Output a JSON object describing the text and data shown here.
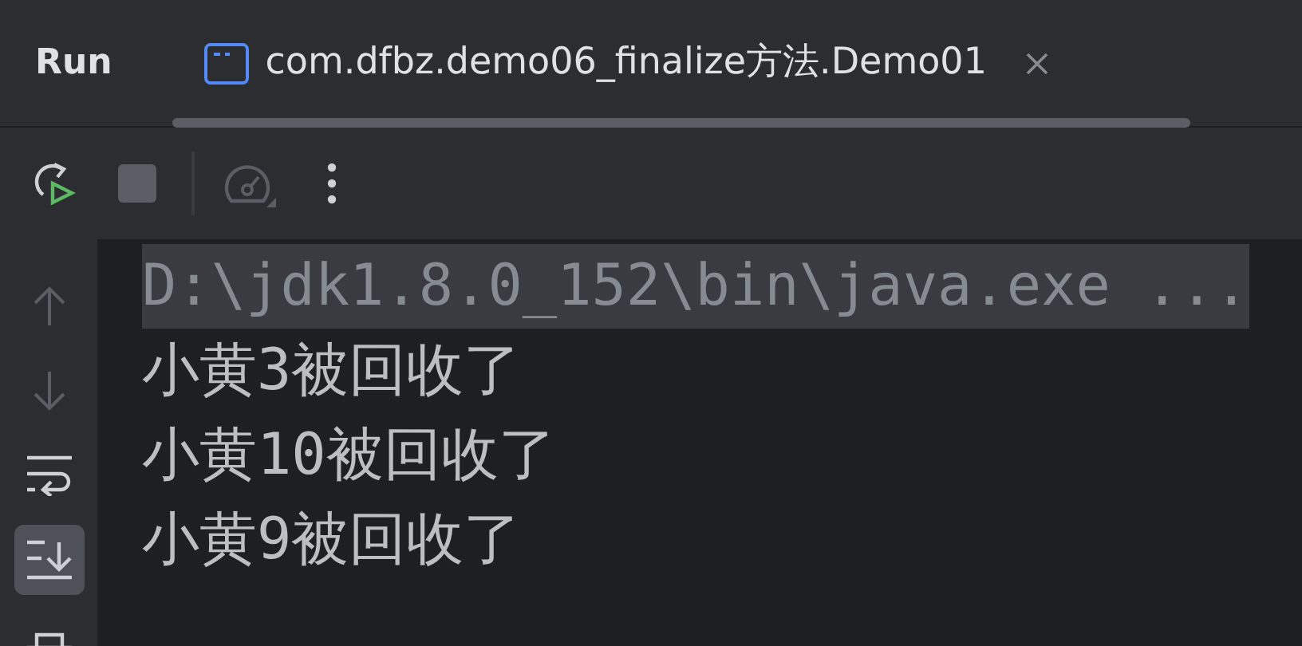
{
  "panel": {
    "title": "Run"
  },
  "tab": {
    "label": "com.dfbz.demo06_finalize方法.Demo01",
    "selected": true
  },
  "toolbar": [
    {
      "kind": "rerun",
      "disabled": false
    },
    {
      "kind": "stop",
      "disabled": true
    },
    {
      "kind": "divider",
      "disabled": false
    },
    {
      "kind": "profiler",
      "disabled": true
    },
    {
      "kind": "more",
      "disabled": false
    }
  ],
  "side_buttons": [
    {
      "kind": "up",
      "disabled": true,
      "selected": false
    },
    {
      "kind": "down",
      "disabled": true,
      "selected": false
    },
    {
      "kind": "wrap",
      "disabled": false,
      "selected": false
    },
    {
      "kind": "scroll-end",
      "disabled": false,
      "selected": true
    },
    {
      "kind": "print",
      "disabled": false,
      "selected": false
    }
  ],
  "console": [
    {
      "kind": "command",
      "text": "D:\\jdk1.8.0_152\\bin\\java.exe ..."
    },
    {
      "kind": "output",
      "text": "小黄3被回收了"
    },
    {
      "kind": "output",
      "text": "小黄10被回收了"
    },
    {
      "kind": "output",
      "text": "小黄9被回收了"
    }
  ]
}
